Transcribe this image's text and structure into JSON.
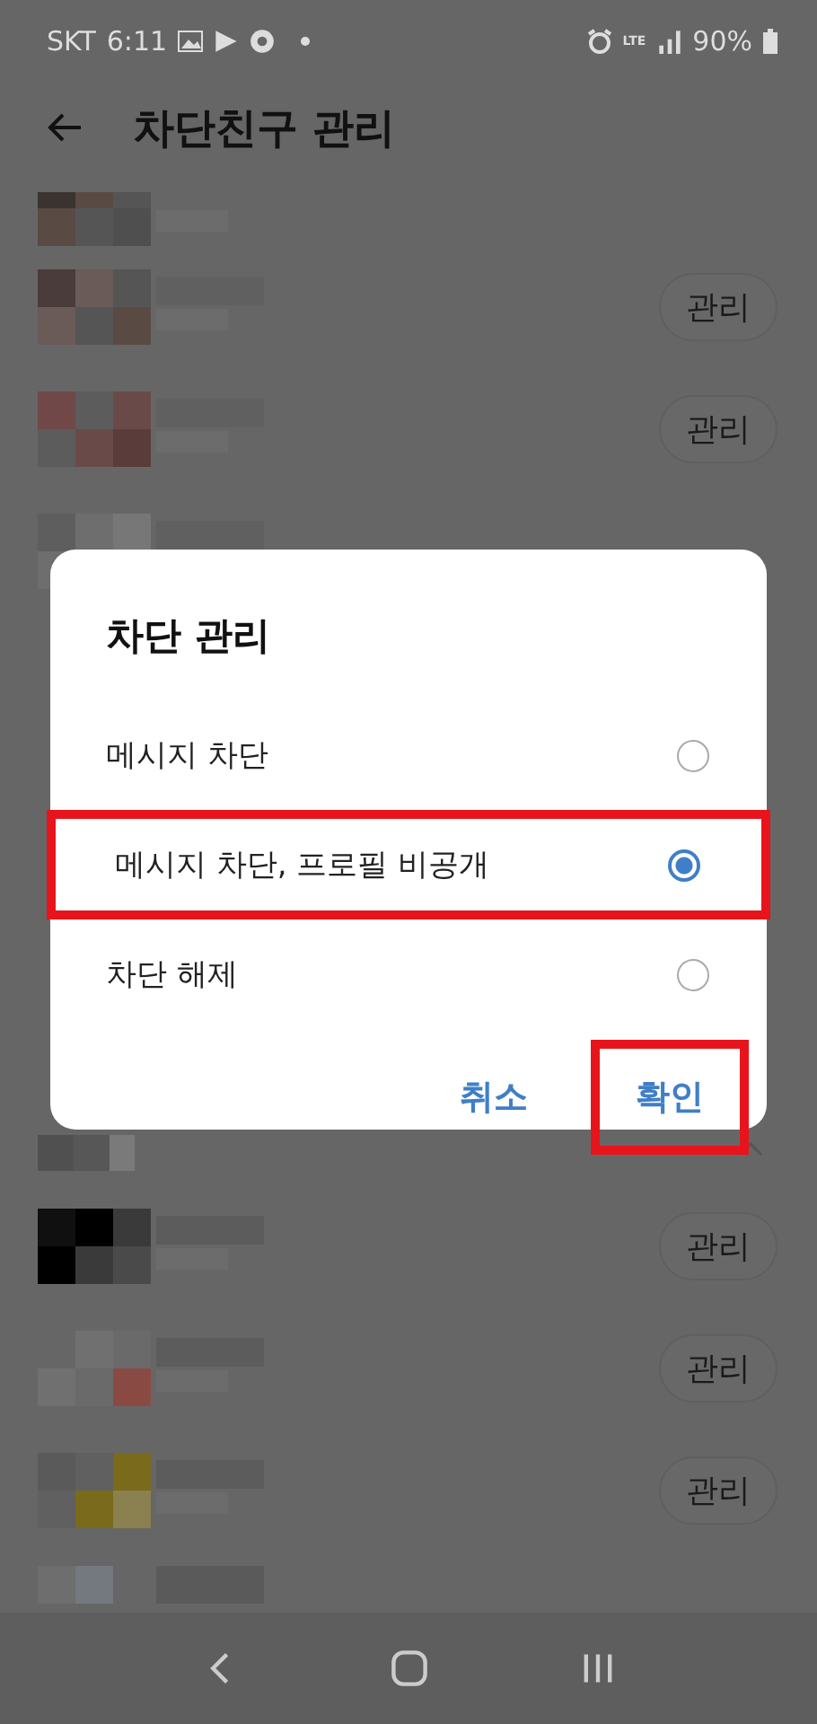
{
  "status_bar": {
    "carrier": "SKT",
    "time": "6:11",
    "network": "LTE",
    "battery": "90%"
  },
  "app_bar": {
    "title": "차단친구 관리"
  },
  "friends_top": [
    {
      "button": "관리"
    },
    {
      "button": "관리"
    }
  ],
  "section": {
    "expanded": true
  },
  "friends_bottom": [
    {
      "button": "관리"
    },
    {
      "button": "관리"
    },
    {
      "button": "관리"
    }
  ],
  "dialog": {
    "title": "차단 관리",
    "options": [
      {
        "label": "메시지 차단",
        "selected": false,
        "highlighted": false
      },
      {
        "label": "메시지 차단, 프로필 비공개",
        "selected": true,
        "highlighted": true
      },
      {
        "label": "차단 해제",
        "selected": false,
        "highlighted": false
      }
    ],
    "buttons": [
      {
        "label": "취소",
        "highlighted": false
      },
      {
        "label": "확인",
        "highlighted": true
      }
    ]
  }
}
